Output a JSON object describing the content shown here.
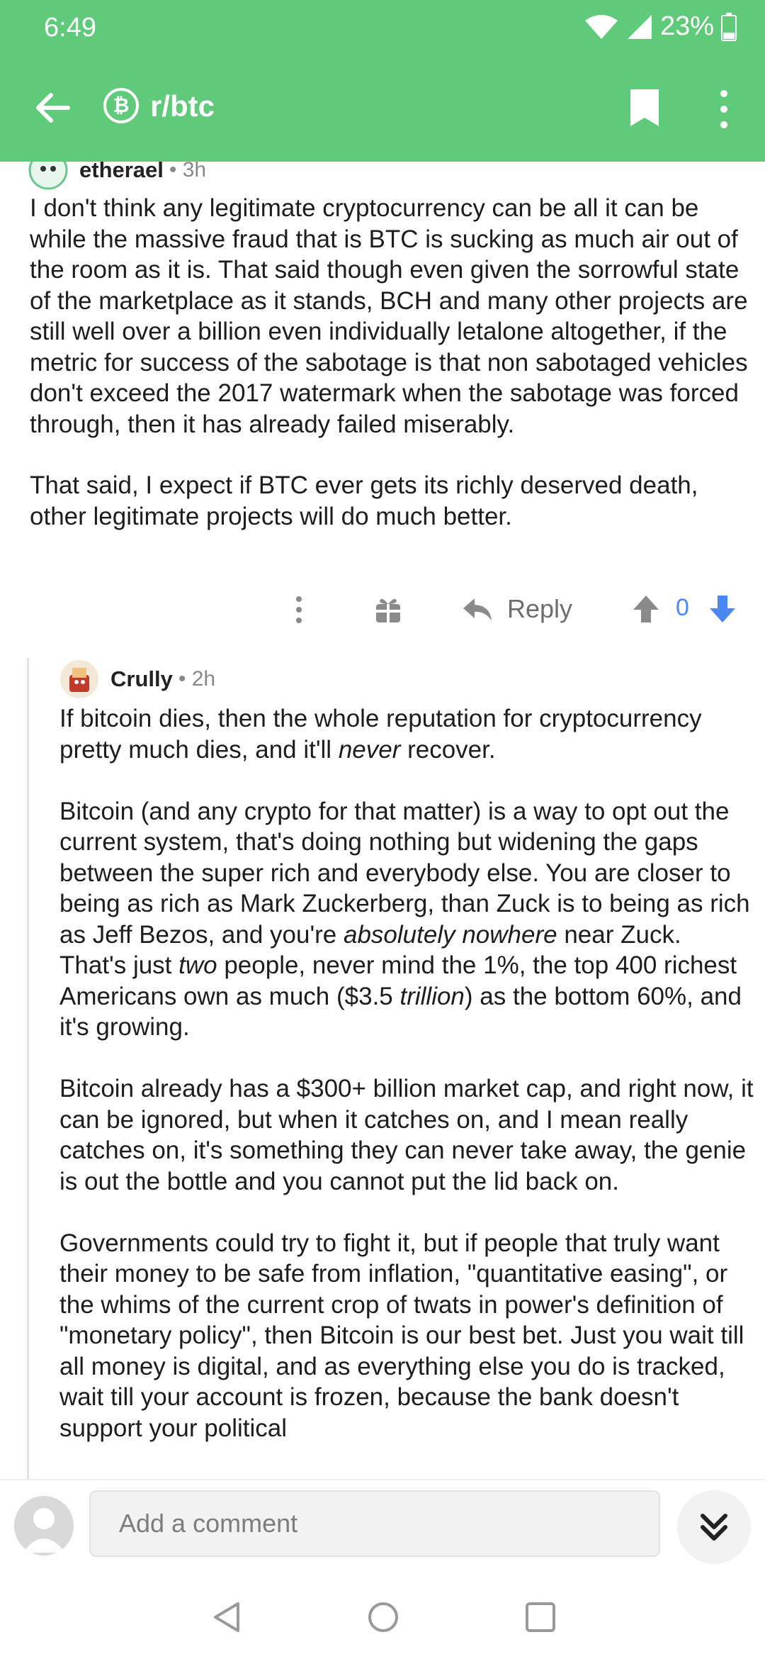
{
  "status_bar": {
    "time": "6:49",
    "battery": "23%"
  },
  "app_bar": {
    "subreddit": "r/btc",
    "subreddit_icon": "bitcoin-b"
  },
  "comments": [
    {
      "author": "etherael",
      "meta": "• 3h",
      "paragraphs": [
        "I don't think any legitimate cryptocurrency can be all it can be while the massive fraud that is BTC is sucking as much air out of the room as it is. That said though even given the sorrowful state of the marketplace as it stands, BCH and many other projects are still well over a billion even individually letalone altogether, if the metric for success of the sabotage is that non sabotaged vehicles don't exceed the 2017 watermark when the sabotage was forced through, then it has already failed miserably.",
        "That said, I expect if BTC ever gets its richly deserved death, other legitimate projects will do much better."
      ],
      "actions": {
        "reply_label": "Reply",
        "score": "0"
      }
    },
    {
      "author": "Crully",
      "meta": "• 2h",
      "p1": {
        "a": "If bitcoin dies, then the whole reputation for cryptocurrency pretty much dies, and it'll ",
        "em": "never",
        "b": " recover."
      },
      "p2": {
        "a": "Bitcoin (and any crypto for that matter) is a way to opt out the current system, that's doing nothing but widening the gaps between the super rich and everybody else.  You are closer to being as rich as Mark Zuckerberg, than Zuck is to being as rich as Jeff Bezos, and you're ",
        "em1": "absolutely nowhere",
        "b": " near Zuck.  That's just ",
        "em2": "two",
        "c": " people, never mind the 1%, the top 400 richest Americans own as much ($3.5 ",
        "em3": "trillion",
        "d": ") as the bottom 60%, and it's growing."
      },
      "p3": "Bitcoin already has a $300+ billion market cap, and right now, it can be ignored, but when it catches on, and I mean really catches on, it's something they can never take away, the genie is out the bottle and you cannot put the lid back on.",
      "p4": "Governments could try to fight it, but if people that truly want their money to be safe from inflation, \"quantitative easing\", or the whims of the current crop of twats in power's definition of \"monetary policy\", then Bitcoin is our best bet.  Just you wait till all money is digital, and as everything else you do is tracked, wait till your account is frozen, because the bank doesn't support your political"
    }
  ],
  "composer": {
    "placeholder": "Add a comment"
  },
  "colors": {
    "accent": "#5fcb7a",
    "vote": "#4a89f5",
    "muted": "#888888"
  }
}
